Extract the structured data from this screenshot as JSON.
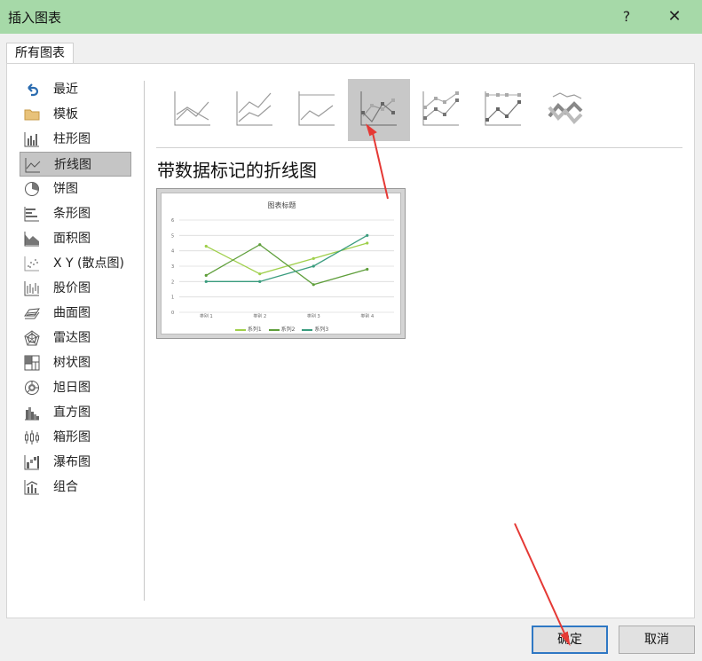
{
  "window": {
    "title": "插入图表",
    "help_icon": "?",
    "close_icon": "✕"
  },
  "tabs": [
    {
      "label": "所有图表"
    }
  ],
  "sidebar": {
    "items": [
      {
        "label": "最近",
        "icon": "undo-icon"
      },
      {
        "label": "模板",
        "icon": "folder-icon"
      },
      {
        "label": "柱形图",
        "icon": "column-chart-icon"
      },
      {
        "label": "折线图",
        "icon": "line-chart-icon",
        "selected": true
      },
      {
        "label": "饼图",
        "icon": "pie-chart-icon"
      },
      {
        "label": "条形图",
        "icon": "bar-chart-icon"
      },
      {
        "label": "面积图",
        "icon": "area-chart-icon"
      },
      {
        "label": "X Y (散点图)",
        "icon": "scatter-chart-icon"
      },
      {
        "label": "股价图",
        "icon": "stock-chart-icon"
      },
      {
        "label": "曲面图",
        "icon": "surface-chart-icon"
      },
      {
        "label": "雷达图",
        "icon": "radar-chart-icon"
      },
      {
        "label": "树状图",
        "icon": "treemap-chart-icon"
      },
      {
        "label": "旭日图",
        "icon": "sunburst-chart-icon"
      },
      {
        "label": "直方图",
        "icon": "histogram-chart-icon"
      },
      {
        "label": "箱形图",
        "icon": "box-whisker-chart-icon"
      },
      {
        "label": "瀑布图",
        "icon": "waterfall-chart-icon"
      },
      {
        "label": "组合",
        "icon": "combo-chart-icon"
      }
    ]
  },
  "subtypes": {
    "selected_index": 3,
    "items": [
      "line-chart-subtype-icon",
      "stacked-line-subtype-icon",
      "percent-stacked-line-subtype-icon",
      "line-with-markers-subtype-icon",
      "stacked-line-markers-subtype-icon",
      "percent-stacked-line-markers-subtype-icon",
      "3d-line-subtype-icon"
    ]
  },
  "preview": {
    "subtitle": "带数据标记的折线图",
    "chart_data": {
      "type": "line",
      "title": "图表标题",
      "categories": [
        "类别 1",
        "类别 2",
        "类别 3",
        "类别 4"
      ],
      "ylim": [
        0,
        6
      ],
      "yticks": [
        "0",
        "1",
        "2",
        "3",
        "4",
        "5",
        "6"
      ],
      "grid": true,
      "legend_position": "bottom",
      "series": [
        {
          "name": "系列1",
          "values": [
            4.3,
            2.5,
            3.5,
            4.5
          ],
          "color": "#9fcf4a"
        },
        {
          "name": "系列2",
          "values": [
            2.4,
            4.4,
            1.8,
            2.8
          ],
          "color": "#5e9e3a"
        },
        {
          "name": "系列3",
          "values": [
            2,
            2,
            3,
            5
          ],
          "color": "#3a9c7e"
        }
      ]
    }
  },
  "buttons": {
    "ok": "确定",
    "cancel": "取消"
  },
  "colors": {
    "titlebar": "#a6d9a8",
    "selected": "#c5c5c5",
    "annotation_arrow": "#e53935",
    "ok_border": "#2f78c4"
  }
}
